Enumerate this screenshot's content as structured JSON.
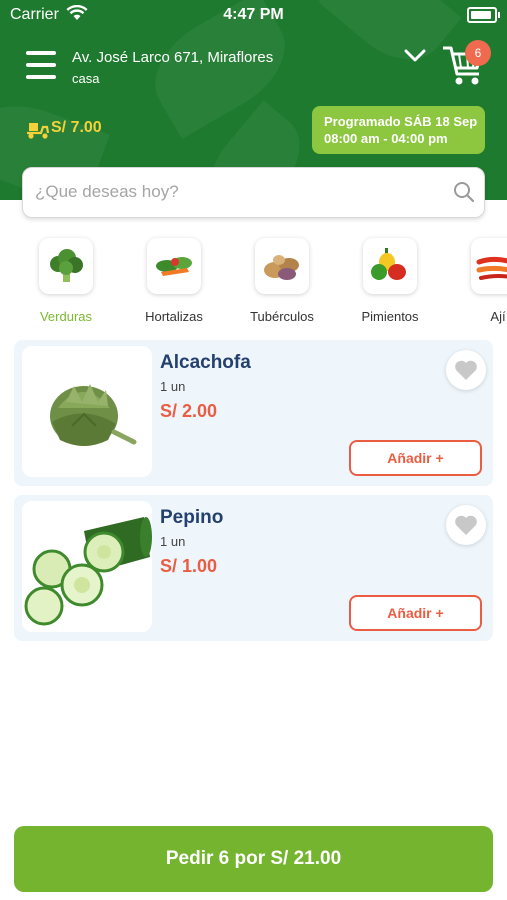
{
  "status_bar": {
    "carrier": "Carrier",
    "time": "4:47 PM"
  },
  "header": {
    "address": "Av. José Larco 671, Miraflores",
    "address_label": "casa",
    "cart_count": "6",
    "delivery_fee": "S/ 7.00",
    "schedule_line1": "Programado SÁB 18 Sep",
    "schedule_line2": "08:00 am - 04:00 pm",
    "brand_color": "#1e7a2e",
    "accent_color": "#8dc63f"
  },
  "search": {
    "placeholder": "¿Que deseas hoy?"
  },
  "categories": [
    {
      "label": "Verduras",
      "icon": "broccoli-icon",
      "active": true
    },
    {
      "label": "Hortalizas",
      "icon": "vegetables-icon",
      "active": false
    },
    {
      "label": "Tubérculos",
      "icon": "potatoes-icon",
      "active": false
    },
    {
      "label": "Pimientos",
      "icon": "peppers-icon",
      "active": false
    },
    {
      "label": "Ají",
      "icon": "chili-icon",
      "active": false
    }
  ],
  "products": [
    {
      "name": "Alcachofa",
      "unit": "1 un",
      "price": "S/ 2.00",
      "add_label": "Añadir +",
      "image": "artichoke-image"
    },
    {
      "name": "Pepino",
      "unit": "1 un",
      "price": "S/ 1.00",
      "add_label": "Añadir +",
      "image": "cucumber-image"
    }
  ],
  "footer": {
    "order_label": "Pedir 6 por S/ 21.00"
  }
}
